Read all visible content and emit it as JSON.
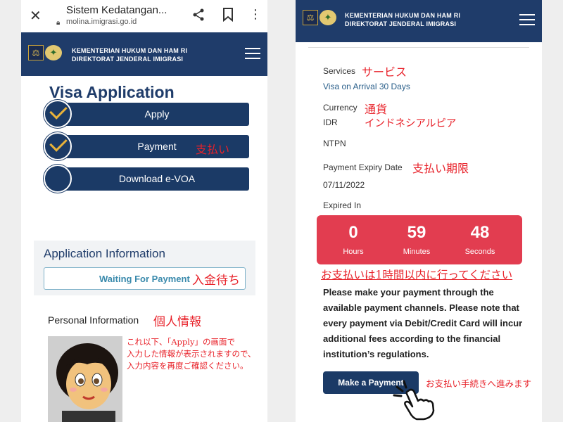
{
  "browser": {
    "tab_title": "Sistem Kedatangan...",
    "url": "molina.imigrasi.go.id"
  },
  "header": {
    "org_line1": "KEMENTERIAN HUKUM DAN HAM RI",
    "org_line2": "DIREKTORAT JENDERAL IMIGRASI"
  },
  "left": {
    "title": "Visa Application",
    "steps": [
      {
        "label": "Apply",
        "done": true
      },
      {
        "label": "Payment",
        "done": true
      },
      {
        "label": "Download e-VOA",
        "done": false
      }
    ],
    "payment_note_jp": "支払い",
    "info_title": "Application Information",
    "status": "Waiting For Payment",
    "status_note_jp": "入金待ち",
    "personal_label": "Personal Information",
    "personal_note_jp": "個人情報",
    "annotation_lines": [
      "これ以下、「Apply」の画面で",
      "入力した情報が表示されますので、",
      "入力内容を再度ご確認ください。"
    ]
  },
  "right": {
    "services_label": "Services",
    "services_jp": "サービス",
    "services_value": "Visa on Arrival 30 Days",
    "currency_label": "Currency",
    "currency_jp": "通貨",
    "currency_value": "IDR",
    "currency_value_jp": "インドネシアルピア",
    "ntpn_label": "NTPN",
    "expiry_label": "Payment Expiry Date",
    "expiry_jp": "支払い期限",
    "expiry_value": "07/11/2022",
    "expired_in_label": "Expired In",
    "countdown": [
      {
        "value": "0",
        "unit": "Hours"
      },
      {
        "value": "59",
        "unit": "Minutes"
      },
      {
        "value": "48",
        "unit": "Seconds"
      }
    ],
    "deadline_note_jp": "お支払いは1時間以内に行ってください",
    "pay_message": "Please make your payment through the available payment channels. Please note that every payment via Debit/Credit Card will incur additional fees according to the financial institution’s regulations.",
    "pay_button": "Make a Payment",
    "pay_note_jp": "お支払い手続きへ進みます"
  },
  "colors": {
    "navy": "#1f3c6a",
    "red_note": "#e8222a",
    "countdown_bg": "#e23d50",
    "status_text": "#3a8aac"
  }
}
